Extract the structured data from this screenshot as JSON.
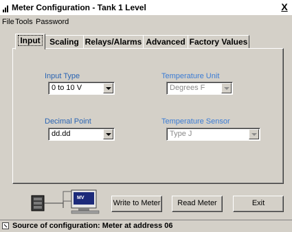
{
  "window": {
    "title": "Meter Configuration - Tank 1 Level",
    "close_label": "X"
  },
  "menu": {
    "items": [
      "File",
      "Tools",
      "Password"
    ]
  },
  "tabs": [
    {
      "label": "Input",
      "active": true
    },
    {
      "label": "Scaling",
      "active": false
    },
    {
      "label": "Relays/Alarms",
      "active": false
    },
    {
      "label": "Advanced",
      "active": false
    },
    {
      "label": "Factory Values",
      "active": false
    }
  ],
  "input_tab": {
    "input_type": {
      "label": "Input Type",
      "value": "0 to 10 V",
      "enabled": true
    },
    "temperature_unit": {
      "label": "Temperature Unit",
      "value": "Degrees F",
      "enabled": false
    },
    "decimal_point": {
      "label": "Decimal Point",
      "value": "dd.dd",
      "enabled": true
    },
    "temperature_sensor": {
      "label": "Temperature Sensor",
      "value": "Type J",
      "enabled": false
    }
  },
  "buttons": {
    "write": "Write to Meter",
    "read": "Read Meter",
    "exit": "Exit"
  },
  "graphic": {
    "meter_badge": "MV"
  },
  "status": {
    "text": "Source of configuration: Meter at address 06"
  },
  "colors": {
    "label_blue": "#2a64b3",
    "window_bg": "#d4d0c8"
  }
}
